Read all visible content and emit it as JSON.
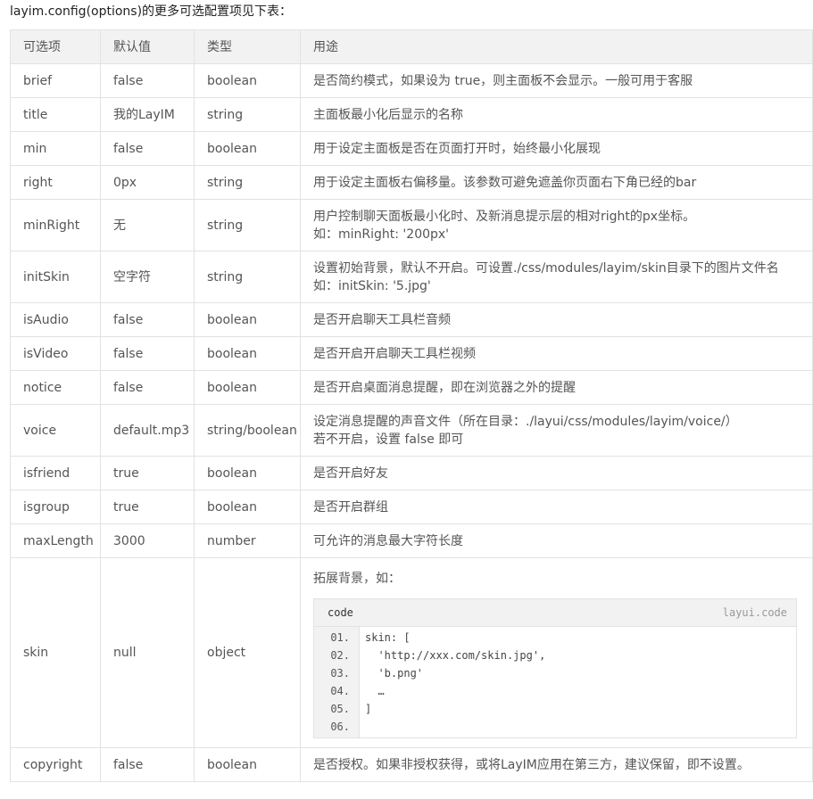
{
  "intro": "layim.config(options)的更多可选配置项见下表：",
  "headers": [
    "可选项",
    "默认值",
    "类型",
    "用途"
  ],
  "rows": [
    {
      "option": "brief",
      "default": "false",
      "type": "boolean",
      "desc": [
        "是否简约模式，如果设为 true，则主面板不会显示。一般可用于客服"
      ]
    },
    {
      "option": "title",
      "default": "我的LayIM",
      "type": "string",
      "desc": [
        "主面板最小化后显示的名称"
      ]
    },
    {
      "option": "min",
      "default": "false",
      "type": "boolean",
      "desc": [
        "用于设定主面板是否在页面打开时，始终最小化展现"
      ]
    },
    {
      "option": "right",
      "default": "0px",
      "type": "string",
      "desc": [
        "用于设定主面板右偏移量。该参数可避免遮盖你页面右下角已经的bar"
      ]
    },
    {
      "option": "minRight",
      "default": "无",
      "type": "string",
      "desc": [
        "用户控制聊天面板最小化时、及新消息提示层的相对right的px坐标。",
        "如：minRight: '200px'"
      ]
    },
    {
      "option": "initSkin",
      "default": "空字符",
      "type": "string",
      "desc": [
        "设置初始背景，默认不开启。可设置./css/modules/layim/skin目录下的图片文件名",
        "如：initSkin: '5.jpg'"
      ]
    },
    {
      "option": "isAudio",
      "default": "false",
      "type": "boolean",
      "desc": [
        "是否开启聊天工具栏音频"
      ]
    },
    {
      "option": "isVideo",
      "default": "false",
      "type": "boolean",
      "desc": [
        "是否开启开启聊天工具栏视频"
      ]
    },
    {
      "option": "notice",
      "default": "false",
      "type": "boolean",
      "desc": [
        "是否开启桌面消息提醒，即在浏览器之外的提醒"
      ]
    },
    {
      "option": "voice",
      "default": "default.mp3",
      "type": "string/boolean",
      "desc": [
        "设定消息提醒的声音文件（所在目录：./layui/css/modules/layim/voice/）",
        "若不开启，设置 false 即可"
      ]
    },
    {
      "option": "isfriend",
      "default": "true",
      "type": "boolean",
      "desc": [
        "是否开启好友"
      ]
    },
    {
      "option": "isgroup",
      "default": "true",
      "type": "boolean",
      "desc": [
        "是否开启群组"
      ]
    },
    {
      "option": "maxLength",
      "default": "3000",
      "type": "number",
      "desc": [
        "可允许的消息最大字符长度"
      ]
    }
  ],
  "skin_row": {
    "option": "skin",
    "default": "null",
    "type": "object",
    "desc": "拓展背景，如：",
    "code_title": "code",
    "code_brand": "layui.code",
    "line_numbers": [
      "01.",
      "02.",
      "03.",
      "04.",
      "05.",
      "06."
    ],
    "code_lines": [
      "skin: [",
      "  'http://xxx.com/skin.jpg',",
      "  'b.png'",
      "  …",
      "]",
      ""
    ]
  },
  "last_row": {
    "option": "copyright",
    "default": "false",
    "type": "boolean",
    "desc": "是否授权。如果非授权获得，或将LayIM应用在第三方，建议保留，即不设置。"
  }
}
